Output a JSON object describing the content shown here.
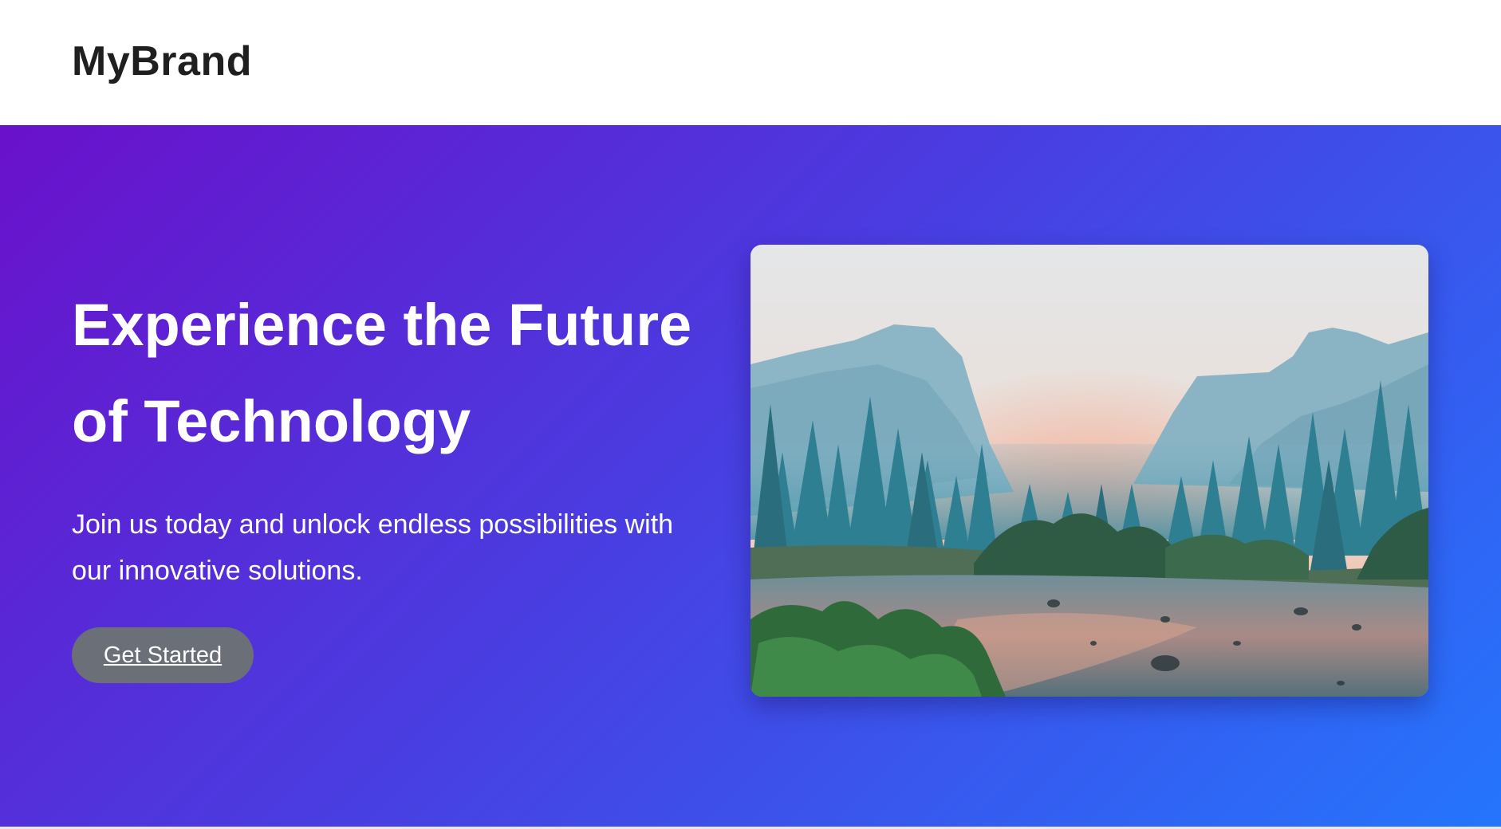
{
  "navbar": {
    "brand": "MyBrand"
  },
  "hero": {
    "title_line1": "Experience the Future",
    "title_line2": "of Technology",
    "subtitle_line1": "Join us today and unlock endless possibilities with",
    "subtitle_line2": "our innovative solutions.",
    "cta_label": "Get Started",
    "image_alt": "Mountain valley with pine forest and river at sunrise"
  },
  "colors": {
    "gradient_start": "#6a11cb",
    "gradient_end": "#2575fc",
    "cta_background": "#6b6f78",
    "brand_text": "#1f1f1f"
  }
}
